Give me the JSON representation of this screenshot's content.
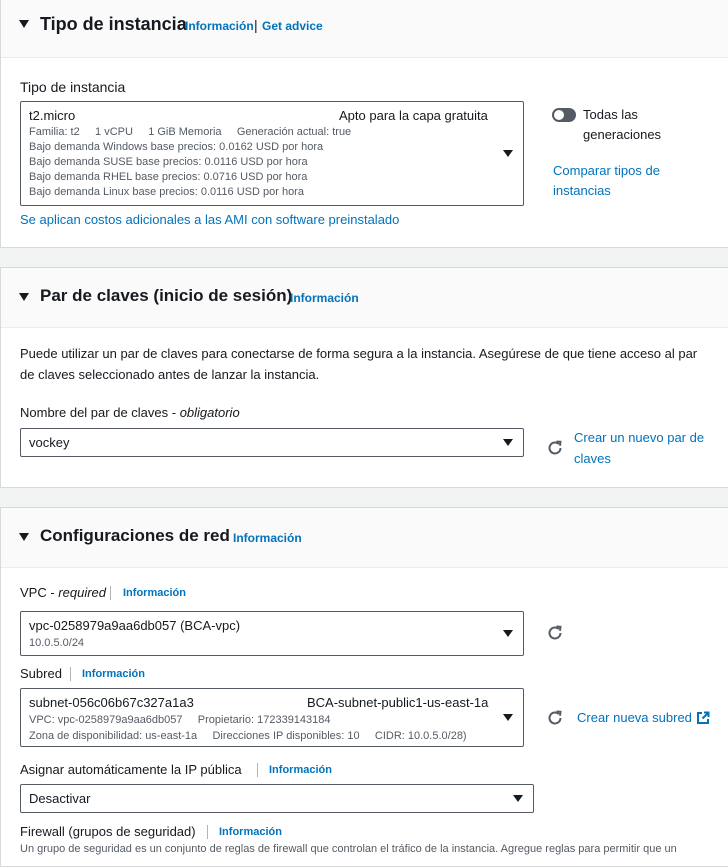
{
  "instance_type_section": {
    "title": "Tipo de instancia",
    "info_link": "Información",
    "divider": "|",
    "advice_link": "Get advice",
    "field_label": "Tipo de instancia",
    "selected": {
      "name": "t2.micro",
      "free_tier": "Apto para la capa gratuita",
      "details_line1": "Familia: t2     1 vCPU     1 GiB Memoria     Generación actual: true",
      "price_windows": "Bajo demanda Windows base precios: 0.0162 USD por hora",
      "price_suse": "Bajo demanda SUSE base precios: 0.0116 USD por hora",
      "price_rhel": "Bajo demanda RHEL base precios: 0.0716 USD por hora",
      "price_linux": "Bajo demanda Linux base precios: 0.0116 USD por hora"
    },
    "all_generations_line1": "Todas las",
    "all_generations_line2": "generaciones",
    "compare_line1": "Comparar tipos de",
    "compare_line2": "instancias",
    "ami_costs_link": "Se aplican costos adicionales a las AMI con software preinstalado"
  },
  "key_pair_section": {
    "title": "Par de claves (inicio de sesión)",
    "info_link": "Información",
    "description_line1": "Puede utilizar un par de claves para conectarse de forma segura a la instancia. Asegúrese de que tiene acceso al par",
    "description_line2": "de claves seleccionado antes de lanzar la instancia.",
    "field_label": "Nombre del par de claves - ",
    "field_label_required": "obligatorio",
    "selected": "vockey",
    "create_line1": "Crear un nuevo par de",
    "create_line2": "claves"
  },
  "network_section": {
    "title": "Configuraciones de red",
    "info_link": "Información",
    "vpc_label": "VPC - ",
    "vpc_required": "required",
    "vpc_info": "Información",
    "vpc_selected": "vpc-0258979a9aa6db057 (BCA-vpc)",
    "vpc_cidr": "10.0.5.0/24",
    "subnet_label": "Subred",
    "subnet_info": "Información",
    "subnet_id": "subnet-056c06b67c327a1a3",
    "subnet_name": "BCA-subnet-public1-us-east-1a",
    "subnet_line2": "VPC: vpc-0258979a9aa6db057     Propietario: 172339143184",
    "subnet_line3": "Zona de disponibilidad: us-east-1a     Direcciones IP disponibles: 10     CIDR: 10.0.5.0/28)",
    "create_subnet": "Crear nueva subred",
    "public_ip_label": "Asignar automáticamente la IP pública",
    "public_ip_info": "Información",
    "public_ip_selected": "Desactivar",
    "firewall_label": "Firewall (grupos de seguridad)",
    "firewall_info": "Información",
    "firewall_desc": "Un grupo de seguridad es un conjunto de reglas de firewall que controlan el tráfico de la instancia. Agregue reglas para permitir que un"
  },
  "colors": {
    "link": "#0073bb",
    "text": "#16191f",
    "border": "#545b64",
    "background": "#f2f3f3"
  }
}
